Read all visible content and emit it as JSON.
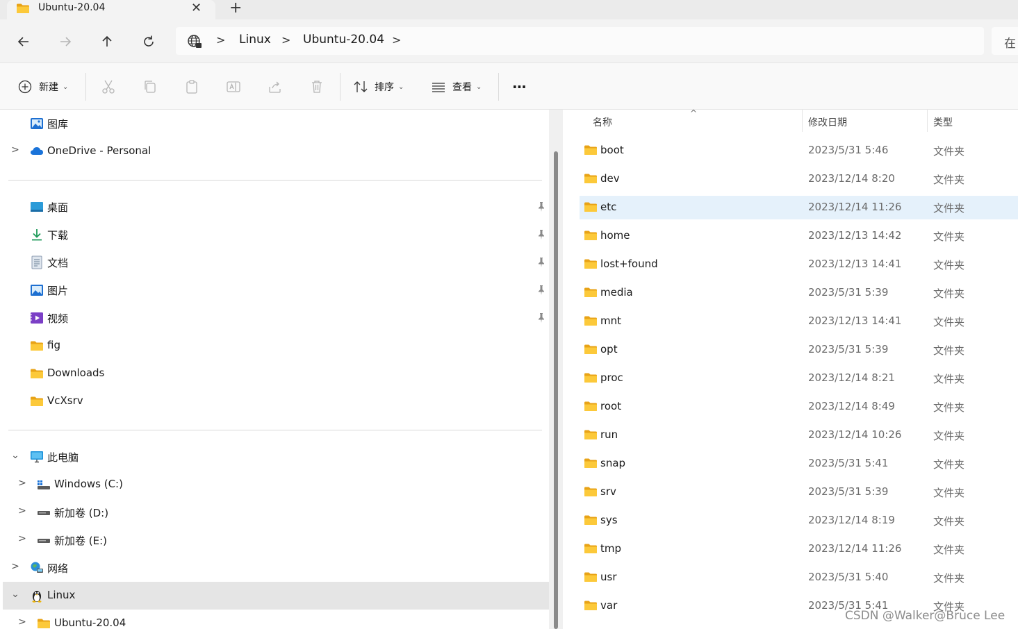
{
  "tab": {
    "title": "Ubuntu-20.04",
    "close": "✕",
    "new": "+"
  },
  "breadcrumb": [
    "Linux",
    "Ubuntu-20.04"
  ],
  "search_placeholder": "在",
  "toolbar": {
    "new_label": "新建",
    "sort_label": "排序",
    "view_label": "查看",
    "more": "···"
  },
  "sidebar": {
    "group1": [
      {
        "label": "图库",
        "icon": "gallery-icon",
        "chevron": ""
      },
      {
        "label": "OneDrive - Personal",
        "icon": "cloud-icon",
        "chevron": ">"
      }
    ],
    "quick_access": [
      {
        "label": "桌面",
        "icon": "desktop-icon",
        "pinned": true
      },
      {
        "label": "下载",
        "icon": "download-icon",
        "pinned": true
      },
      {
        "label": "文档",
        "icon": "document-icon",
        "pinned": true
      },
      {
        "label": "图片",
        "icon": "pictures-icon",
        "pinned": true
      },
      {
        "label": "视频",
        "icon": "videos-icon",
        "pinned": true
      },
      {
        "label": "fig",
        "icon": "folder-icon",
        "pinned": false
      },
      {
        "label": "Downloads",
        "icon": "folder-icon",
        "pinned": false
      },
      {
        "label": "VcXsrv",
        "icon": "folder-icon",
        "pinned": false
      }
    ],
    "this_pc": {
      "label": "此电脑",
      "icon": "computer-icon"
    },
    "drives": [
      {
        "label": "Windows (C:)",
        "icon": "windows-drive-icon"
      },
      {
        "label": "新加卷 (D:)",
        "icon": "drive-icon"
      },
      {
        "label": "新加卷 (E:)",
        "icon": "drive-icon"
      }
    ],
    "network": {
      "label": "网络",
      "icon": "network-icon"
    },
    "linux": {
      "label": "Linux",
      "icon": "linux-penguin-icon"
    },
    "linux_child": {
      "label": "Ubuntu-20.04",
      "icon": "folder-icon"
    }
  },
  "columns": {
    "name": "名称",
    "date": "修改日期",
    "type": "类型"
  },
  "files": [
    {
      "name": "boot",
      "date": "2023/5/31 5:46",
      "type": "文件夹"
    },
    {
      "name": "dev",
      "date": "2023/12/14 8:20",
      "type": "文件夹"
    },
    {
      "name": "etc",
      "date": "2023/12/14 11:26",
      "type": "文件夹"
    },
    {
      "name": "home",
      "date": "2023/12/13 14:42",
      "type": "文件夹"
    },
    {
      "name": "lost+found",
      "date": "2023/12/13 14:41",
      "type": "文件夹"
    },
    {
      "name": "media",
      "date": "2023/5/31 5:39",
      "type": "文件夹"
    },
    {
      "name": "mnt",
      "date": "2023/12/13 14:41",
      "type": "文件夹"
    },
    {
      "name": "opt",
      "date": "2023/5/31 5:39",
      "type": "文件夹"
    },
    {
      "name": "proc",
      "date": "2023/12/14 8:21",
      "type": "文件夹"
    },
    {
      "name": "root",
      "date": "2023/12/14 8:49",
      "type": "文件夹"
    },
    {
      "name": "run",
      "date": "2023/12/14 10:26",
      "type": "文件夹"
    },
    {
      "name": "snap",
      "date": "2023/5/31 5:41",
      "type": "文件夹"
    },
    {
      "name": "srv",
      "date": "2023/5/31 5:39",
      "type": "文件夹"
    },
    {
      "name": "sys",
      "date": "2023/12/14 8:19",
      "type": "文件夹"
    },
    {
      "name": "tmp",
      "date": "2023/12/14 11:26",
      "type": "文件夹"
    },
    {
      "name": "usr",
      "date": "2023/5/31 5:40",
      "type": "文件夹"
    },
    {
      "name": "var",
      "date": "2023/5/31 5:41",
      "type": "文件夹"
    }
  ],
  "selected_file": "etc",
  "watermark": "CSDN @Walker@Bruce Lee",
  "colors": {
    "folder": "#f8c42c",
    "selection": "#e5f1fb",
    "nav_selected": "#e5e5e5",
    "accent": "#0f6cbd"
  }
}
